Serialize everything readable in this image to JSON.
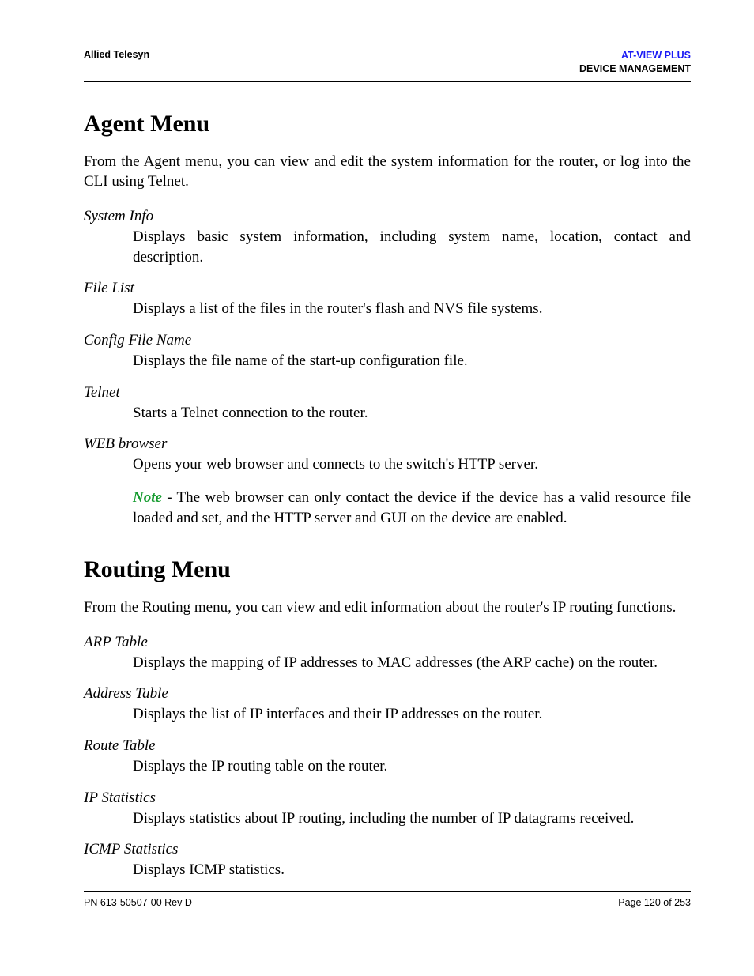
{
  "header": {
    "left": "Allied Telesyn",
    "right_line1": "AT-VIEW PLUS",
    "right_line2": "DEVICE MANAGEMENT"
  },
  "sections": {
    "agent": {
      "heading": "Agent Menu",
      "intro": "From the Agent menu, you can view and edit the system information for the router, or log into the CLI using Telnet.",
      "items": [
        {
          "term": "System Info",
          "desc": "Displays basic system information, including system name, location, contact and description."
        },
        {
          "term": "File List",
          "desc": "Displays a list of the files in the router's flash and NVS file systems."
        },
        {
          "term": "Config File Name",
          "desc": "Displays the file name of the start-up configuration file."
        },
        {
          "term": "Telnet",
          "desc": "Starts a Telnet connection to the router."
        },
        {
          "term": "WEB browser",
          "desc": "Opens your web browser and connects to the switch's HTTP server."
        }
      ],
      "note_label": "Note",
      "note_text": " - The web browser can only contact the device if the device has a valid resource file loaded and set, and the HTTP server and GUI on the device are enabled."
    },
    "routing": {
      "heading": "Routing Menu",
      "intro": "From the Routing menu, you can view and edit information about the router's IP routing functions.",
      "items": [
        {
          "term": "ARP Table",
          "desc": "Displays the mapping of IP addresses to MAC addresses (the ARP cache) on the router."
        },
        {
          "term": "Address Table",
          "desc": "Displays the list of IP interfaces and their IP addresses on the router."
        },
        {
          "term": "Route Table",
          "desc": "Displays the IP routing table on the router."
        },
        {
          "term": "IP Statistics",
          "desc": "Displays statistics about IP routing, including the number of IP datagrams received."
        },
        {
          "term": "ICMP Statistics",
          "desc": "Displays ICMP statistics."
        }
      ]
    }
  },
  "footer": {
    "left": "PN 613-50507-00 Rev D",
    "right": "Page 120 of 253"
  }
}
